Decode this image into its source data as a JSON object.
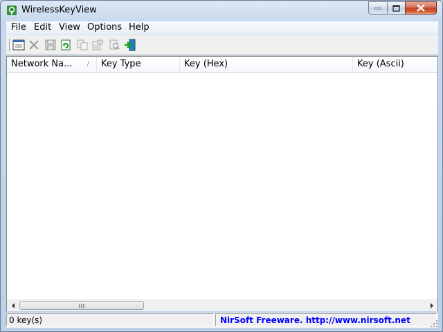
{
  "window": {
    "title": "WirelessKeyView",
    "icon": "wireless-key-app-icon"
  },
  "menu": {
    "items": [
      {
        "label": "File"
      },
      {
        "label": "Edit"
      },
      {
        "label": "View"
      },
      {
        "label": "Options"
      },
      {
        "label": "Help"
      }
    ]
  },
  "toolbar": {
    "buttons": [
      {
        "icon": "html-report-icon",
        "enabled": true
      },
      {
        "icon": "delete-icon",
        "enabled": false
      },
      {
        "icon": "save-icon",
        "enabled": false
      },
      {
        "icon": "refresh-icon",
        "enabled": true
      },
      {
        "icon": "copy-icon",
        "enabled": false
      },
      {
        "icon": "properties-icon",
        "enabled": false
      },
      {
        "icon": "find-icon",
        "enabled": false
      },
      {
        "icon": "exit-icon",
        "enabled": true
      }
    ]
  },
  "table": {
    "columns": [
      {
        "label": "Network Na..."
      },
      {
        "label": "Key Type"
      },
      {
        "label": "Key (Hex)"
      },
      {
        "label": "Key (Ascii)"
      }
    ],
    "rows": []
  },
  "status": {
    "count": "0 key(s)",
    "link": "NirSoft Freeware.  http://www.nirsoft.net"
  },
  "colors": {
    "link": "#0000ff",
    "close_button": "#c2412b"
  }
}
